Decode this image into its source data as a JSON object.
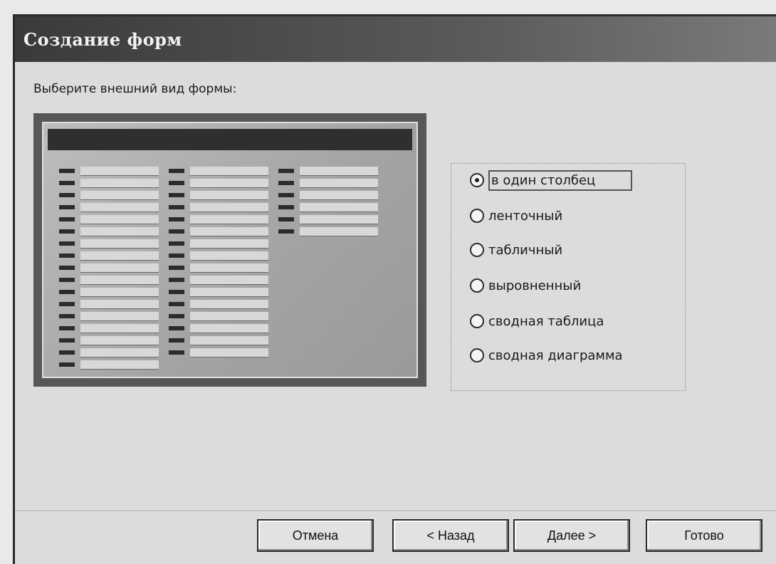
{
  "window": {
    "title": "Создание форм"
  },
  "prompt": "Выберите внешний вид формы:",
  "options": [
    {
      "label": "в один столбец",
      "selected": true
    },
    {
      "label": "ленточный",
      "selected": false
    },
    {
      "label": "табличный",
      "selected": false
    },
    {
      "label": "выровненный",
      "selected": false
    },
    {
      "label": "сводная таблица",
      "selected": false
    },
    {
      "label": "сводная диаграмма",
      "selected": false
    }
  ],
  "buttons": {
    "cancel": "Отмена",
    "back": "< Назад",
    "next": "Далее >",
    "finish": "Готово"
  }
}
